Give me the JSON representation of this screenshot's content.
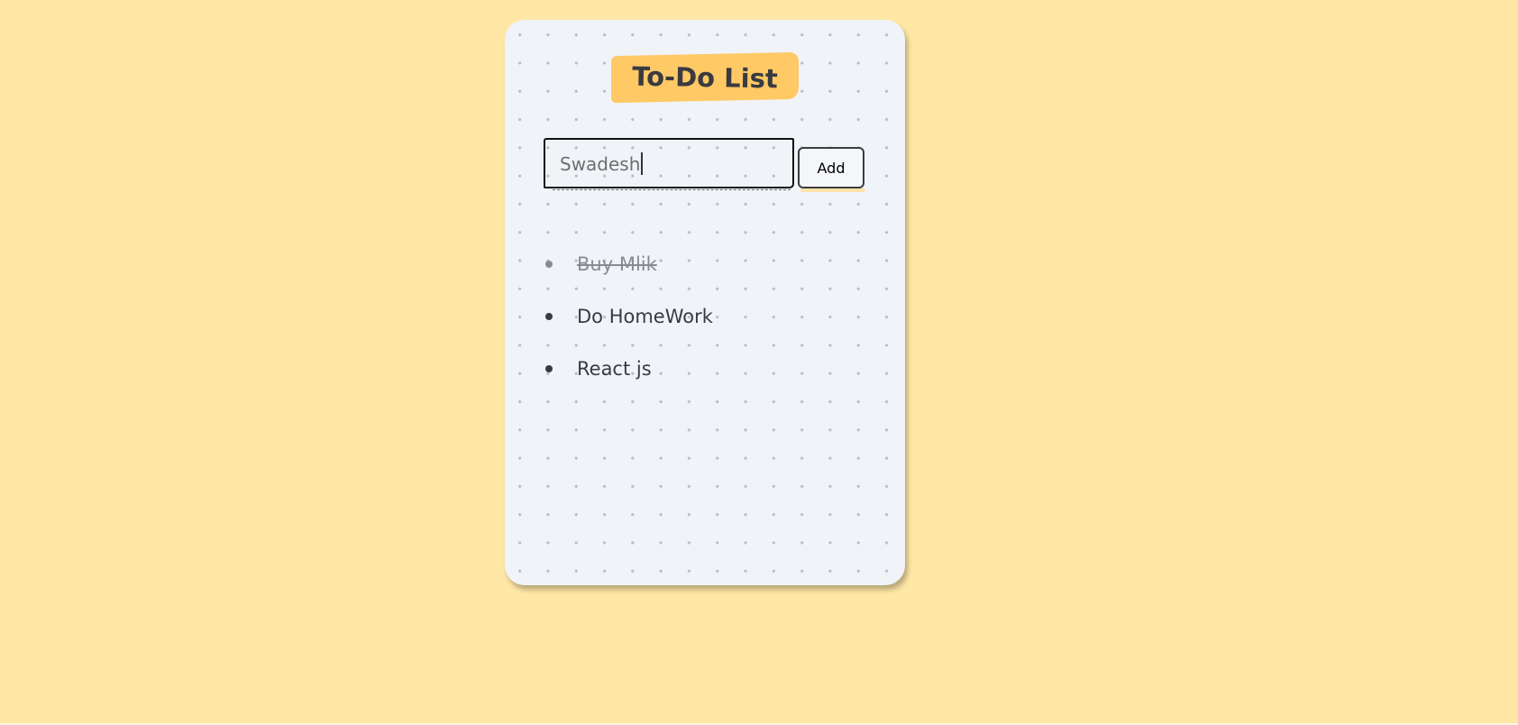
{
  "app": {
    "title": "To-Do List"
  },
  "input": {
    "value": "Swadesh"
  },
  "add_button": {
    "label": "Add"
  },
  "tasks": [
    {
      "label": "Buy Mlik",
      "completed": true
    },
    {
      "label": "Do HomeWork",
      "completed": false
    },
    {
      "label": "React js",
      "completed": false
    }
  ],
  "colors": {
    "page_background": "#ffe8a6",
    "card_background": "#f0f4f9",
    "title_highlight": "#ffc966",
    "text": "#3a3b40",
    "completed_text": "#8a8b90"
  }
}
